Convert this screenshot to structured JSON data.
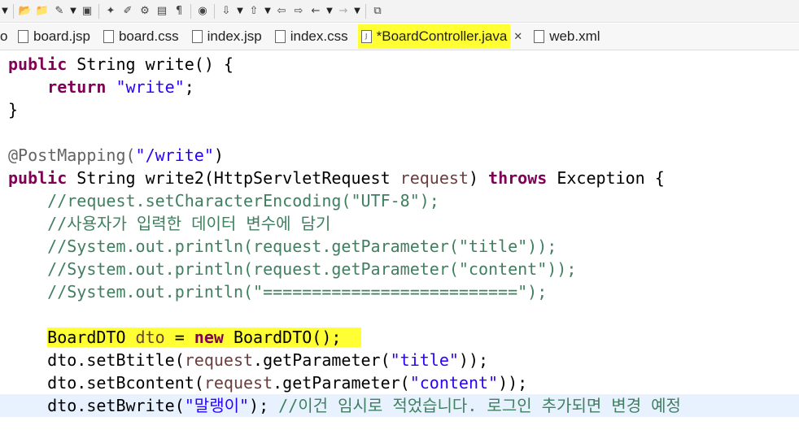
{
  "toolbar": {
    "icons": [
      "dropdown-icon",
      "open-folder-icon",
      "folder-icon",
      "wand-icon",
      "dropdown-icon",
      "package-icon",
      "tag-icon",
      "brush-icon",
      "gear-icon",
      "doc-icon",
      "paragraph-icon",
      "globe-icon",
      "step-icon",
      "dropdown-icon",
      "step-back-icon",
      "dropdown-icon",
      "left-arrow-icon",
      "right-arrow-icon",
      "back-icon",
      "dropdown-icon",
      "forward-icon",
      "dropdown-icon",
      "new-window-icon"
    ]
  },
  "tabs": [
    {
      "label": "board.jsp",
      "icon": "jsp-file-icon"
    },
    {
      "label": "board.css",
      "icon": "css-file-icon"
    },
    {
      "label": "index.jsp",
      "icon": "jsp-file-icon"
    },
    {
      "label": "index.css",
      "icon": "css-file-icon"
    },
    {
      "label": "*BoardController.java",
      "icon": "java-file-icon",
      "active": true
    },
    {
      "label": "web.xml",
      "icon": "xml-file-icon"
    }
  ],
  "code": {
    "l1_kw": "public",
    "l1_rest": " String write() {",
    "l2_kw": "return",
    "l2_str": "\"write\"",
    "l2_end": ";",
    "l3": "}",
    "l5_ann": "@PostMapping(",
    "l5_str": "\"/write\"",
    "l5_end": ")",
    "l6_kw1": "public",
    "l6_mid": " String write2(HttpServletRequest ",
    "l6_par": "request",
    "l6_mid2": ") ",
    "l6_kw2": "throws",
    "l6_end": " Exception {",
    "c1": "//request.setCharacterEncoding(\"UTF-8\");",
    "c2": "//사용자가 입력한 데이터 변수에 담기",
    "c3": "//System.out.println(request.getParameter(\"title\"));",
    "c4": "//System.out.println(request.getParameter(\"content\"));",
    "c5": "//System.out.println(\"==========================\");",
    "d1_a": "BoardDTO ",
    "d1_var": "dto",
    "d1_b": " = ",
    "d1_kw": "new",
    "d1_c": " BoardDTO();",
    "d2_a": "dto.setBtitle(",
    "d2_par": "request",
    "d2_b": ".getParameter(",
    "d2_str": "\"title\"",
    "d2_c": "));",
    "d3_a": "dto.setBcontent(",
    "d3_par": "request",
    "d3_b": ".getParameter(",
    "d3_str": "\"content\"",
    "d3_c": "));",
    "d4_a": "dto.setBwrite(",
    "d4_str": "\"말랭이\"",
    "d4_b": "); ",
    "d4_cm": "//이건 임시로 적었습니다. 로그인 추가되면 변경 예정"
  }
}
